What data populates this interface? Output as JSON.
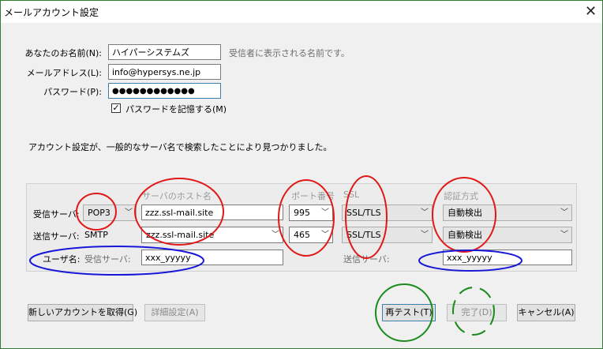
{
  "window": {
    "title": "メールアカウント設定",
    "close_glyph": "✕"
  },
  "form": {
    "name_label": "あなたのお名前(N):",
    "name_value": "ハイパーシステムズ",
    "name_hint": "受信者に表示される名前です。",
    "email_label": "メールアドレス(L):",
    "email_value": "info@hypersys.ne.jp",
    "password_label": "パスワード(P):",
    "password_value": "●●●●●●●●●●●●",
    "remember_label": "パスワードを記憶する(M)",
    "remember_checked": true
  },
  "message": "アカウント設定が、一般的なサーバ名で検索したことにより見つかりました。",
  "server": {
    "headers": {
      "host": "サーバのホスト名",
      "port": "ポート番号",
      "ssl": "SSL",
      "auth": "認証方式"
    },
    "incoming": {
      "label": "受信サーバ:",
      "protocol": "POP3",
      "host": "zzz.ssl-mail.site",
      "port": "995",
      "ssl": "SSL/TLS",
      "auth": "自動検出"
    },
    "outgoing": {
      "label": "送信サーバ:",
      "protocol": "SMTP",
      "host": "zzz.ssl-mail.site",
      "port": "465",
      "ssl": "SSL/TLS",
      "auth": "自動検出"
    },
    "username": {
      "label": "ユーザ名:",
      "incoming_label": "受信サーバ:",
      "incoming_value": "xxx_yyyyy",
      "outgoing_label": "送信サーバ:",
      "outgoing_value": "xxx_yyyyy"
    }
  },
  "buttons": {
    "new_account": "新しいアカウントを取得(G)",
    "advanced": "詳細設定(A)",
    "retest": "再テスト(T)",
    "done": "完了(D)",
    "cancel": "キャンセル(A)"
  },
  "icons": {
    "dropdown": "chevron-down-icon",
    "close": "close-icon",
    "check": "check-icon"
  },
  "annotation_colors": {
    "red": "#e01818",
    "blue": "#1818d8",
    "green": "#1a8a1a"
  }
}
